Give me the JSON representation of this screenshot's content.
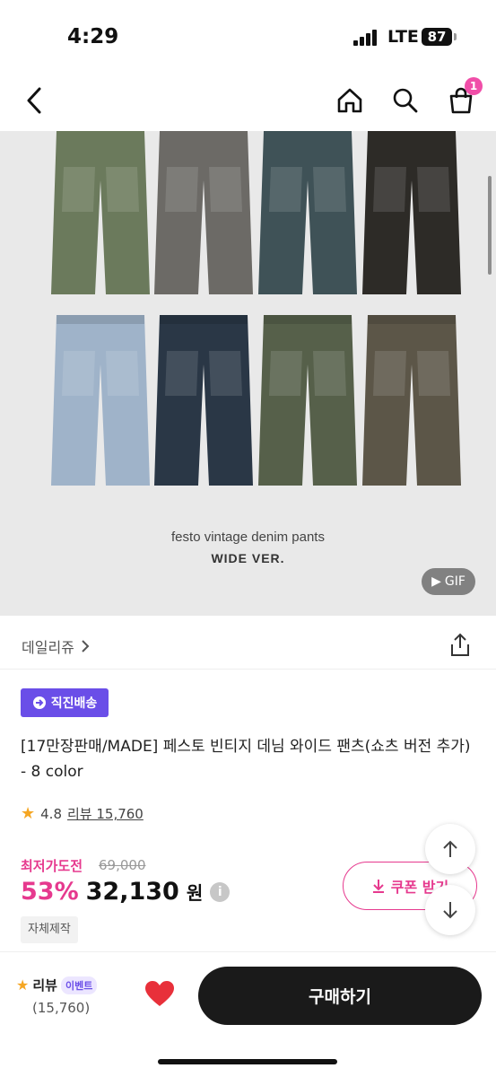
{
  "status_bar": {
    "time": "4:29",
    "network": "LTE",
    "battery": "87"
  },
  "nav": {
    "cart_count": "1"
  },
  "hero": {
    "caption_line1": "festo vintage denim pants",
    "caption_line2": "WIDE VER.",
    "gif_label": "GIF",
    "pants_colors": [
      "#6b7a5c",
      "#6c6a66",
      "#3f5257",
      "#2d2b27",
      "#9fb3c9",
      "#2a3746",
      "#56604a",
      "#5c5648"
    ]
  },
  "brand": {
    "name": "데일리쥬"
  },
  "product": {
    "shipping_badge": "직진배송",
    "title": "[17만장판매/MADE] 페스토 빈티지 데님 와이드 팬츠(쇼츠 버전 추가) - 8 color",
    "rating": "4.8",
    "review_link": "리뷰 15,760",
    "deal_label": "최저가도전",
    "original_price": "69,000",
    "discount": "53%",
    "price": "32,130",
    "currency": "원",
    "tag": "자체제작"
  },
  "coupon": {
    "label": "쿠폰 받기"
  },
  "bottom_bar": {
    "review_label": "리뷰",
    "event_badge": "이벤트",
    "review_count": "(15,760)",
    "buy_label": "구매하기"
  },
  "colors": {
    "accent_pink": "#e6398e",
    "accent_purple": "#6a4ee8",
    "heart_red": "#e8303a"
  }
}
